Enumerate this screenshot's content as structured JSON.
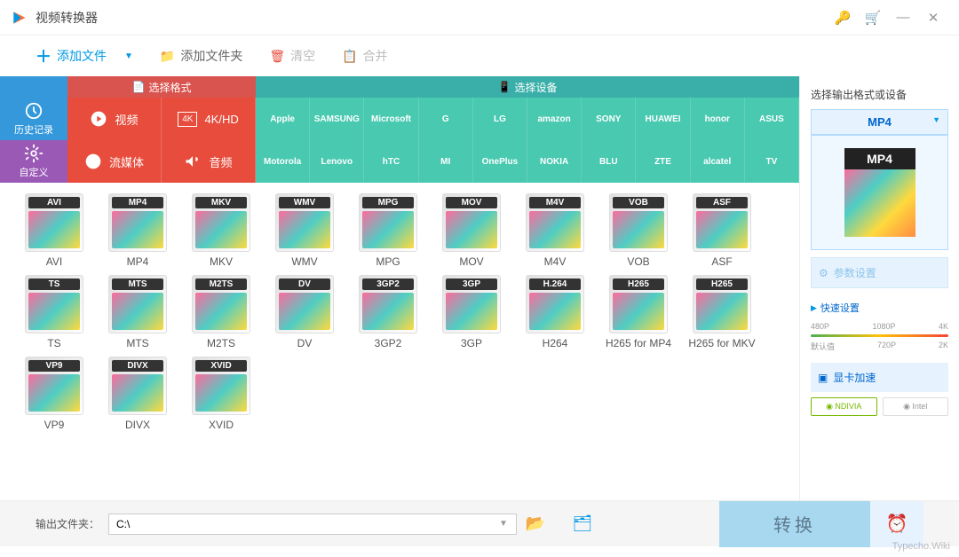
{
  "titlebar": {
    "title": "视频转换器"
  },
  "toolbar": {
    "add_file": "添加文件",
    "add_folder": "添加文件夹",
    "clear": "清空",
    "merge": "合并"
  },
  "left_nav": {
    "history": "历史记录",
    "custom": "自定义"
  },
  "tabs": {
    "format": "选择格式",
    "device": "选择设备"
  },
  "categories": {
    "video": "视频",
    "fourk": "4K/HD",
    "stream": "流媒体",
    "audio": "音频"
  },
  "brands_row1": [
    "Apple",
    "SAMSUNG",
    "Microsoft",
    "G",
    "LG",
    "amazon",
    "SONY",
    "HUAWEI",
    "honor",
    "ASUS"
  ],
  "brands_row2": [
    "Motorola",
    "Lenovo",
    "hTC",
    "MI",
    "OnePlus",
    "NOKIA",
    "BLU",
    "ZTE",
    "alcatel",
    "TV"
  ],
  "formats_row1": [
    {
      "badge": "AVI",
      "label": "AVI"
    },
    {
      "badge": "MP4",
      "label": "MP4"
    },
    {
      "badge": "MKV",
      "label": "MKV"
    },
    {
      "badge": "WMV",
      "label": "WMV"
    },
    {
      "badge": "MPG",
      "label": "MPG"
    },
    {
      "badge": "MOV",
      "label": "MOV"
    },
    {
      "badge": "M4V",
      "label": "M4V"
    },
    {
      "badge": "VOB",
      "label": "VOB"
    },
    {
      "badge": "ASF",
      "label": "ASF"
    },
    {
      "badge": "TS",
      "label": "TS"
    }
  ],
  "formats_row2": [
    {
      "badge": "MTS",
      "label": "MTS"
    },
    {
      "badge": "M2TS",
      "label": "M2TS"
    },
    {
      "badge": "DV",
      "label": "DV"
    },
    {
      "badge": "3GP2",
      "label": "3GP2"
    },
    {
      "badge": "3GP",
      "label": "3GP"
    },
    {
      "badge": "H.264",
      "label": "H264"
    },
    {
      "badge": "H265",
      "label": "H265 for MP4"
    },
    {
      "badge": "H265",
      "label": "H265 for MKV"
    },
    {
      "badge": "VP9",
      "label": "VP9"
    },
    {
      "badge": "DIVX",
      "label": "DIVX"
    }
  ],
  "formats_row3": [
    {
      "badge": "XVID",
      "label": "XVID"
    }
  ],
  "sidebar": {
    "title": "选择输出格式或设备",
    "selected": "MP4",
    "preview_badge": "MP4",
    "param_settings": "参数设置",
    "quick": "快速设置",
    "ticks_top": [
      "480P",
      "1080P",
      "4K"
    ],
    "ticks_bottom": [
      "默认值",
      "720P",
      "2K"
    ],
    "gpu": "显卡加速",
    "nvidia": "NDIVIA",
    "intel": "Intel"
  },
  "bottom": {
    "label": "输出文件夹：",
    "path": "C:\\",
    "convert": "转换"
  },
  "watermark": "Typecho.Wiki"
}
